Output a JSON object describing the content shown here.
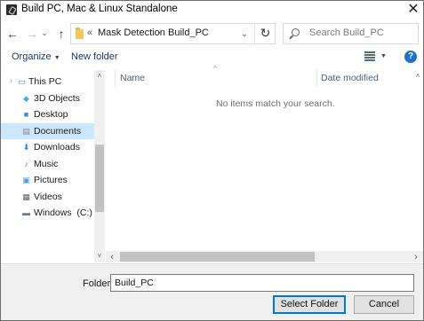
{
  "window": {
    "title": "Build PC, Mac & Linux Standalone",
    "close_glyph": "✕"
  },
  "nav": {
    "back_glyph": "←",
    "forward_glyph": "→",
    "dropdown_glyph": "⌄",
    "up_glyph": "↑",
    "refresh_glyph": "↻",
    "breadcrumb_overflow": "«",
    "breadcrumb": [
      "Mask Detection",
      "Build_PC"
    ],
    "separator": "›",
    "search_placeholder": "Search Build_PC"
  },
  "toolbar": {
    "organize_label": "Organize",
    "new_folder_label": "New folder",
    "help_glyph": "?"
  },
  "sidebar": {
    "items": [
      {
        "label": "This PC",
        "icon": "computer-icon",
        "glyph": "▭",
        "color": "#3a7bd5"
      },
      {
        "label": "3D Objects",
        "icon": "cube-icon",
        "glyph": "◆",
        "color": "#3bb0e3"
      },
      {
        "label": "Desktop",
        "icon": "desktop-icon",
        "glyph": "■",
        "color": "#2d8fe0"
      },
      {
        "label": "Documents",
        "icon": "document-icon",
        "glyph": "▤",
        "color": "#7f8a96",
        "selected": true
      },
      {
        "label": "Downloads",
        "icon": "download-icon",
        "glyph": "⬇",
        "color": "#2d7fd3"
      },
      {
        "label": "Music",
        "icon": "music-icon",
        "glyph": "♪",
        "color": "#2d7fd3"
      },
      {
        "label": "Pictures",
        "icon": "pictures-icon",
        "glyph": "▣",
        "color": "#4aa0e0"
      },
      {
        "label": "Videos",
        "icon": "video-icon",
        "glyph": "▦",
        "color": "#5a6270"
      },
      {
        "label": "Windows  (C:)",
        "icon": "drive-icon",
        "glyph": "▬",
        "color": "#6c7886"
      }
    ]
  },
  "content": {
    "columns": [
      "Name",
      "Date modified"
    ],
    "sort_glyph": "^",
    "empty_message": "No items match your search."
  },
  "scroll": {
    "up_glyph": "˄",
    "down_glyph": "˅",
    "left_glyph": "‹",
    "right_glyph": "›"
  },
  "footer": {
    "folder_label": "Folder:",
    "folder_value": "Build_PC",
    "select_label": "Select Folder",
    "cancel_label": "Cancel"
  },
  "colors": {
    "selection": "#cce8ff",
    "accent": "#0078d7",
    "help": "#1f6fd1"
  }
}
